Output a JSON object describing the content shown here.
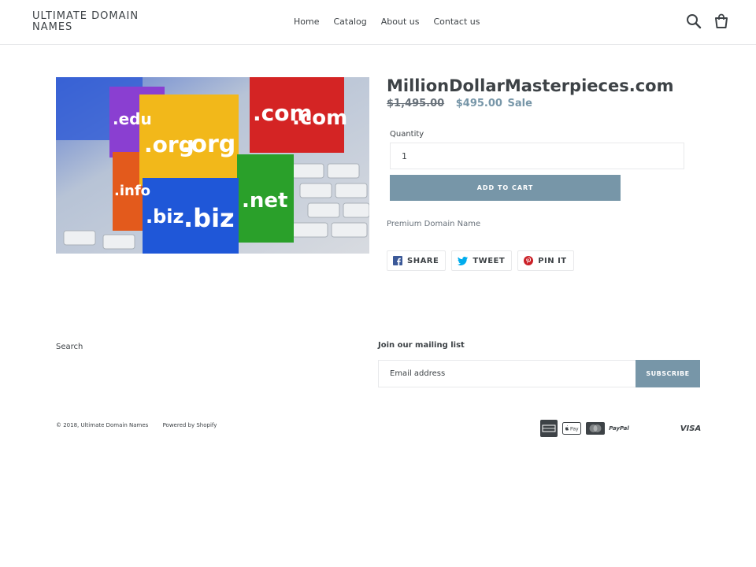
{
  "header": {
    "logo": "ULTIMATE DOMAIN NAMES",
    "nav": [
      "Home",
      "Catalog",
      "About us",
      "Contact us"
    ],
    "icons": [
      "search-icon",
      "cart-icon"
    ]
  },
  "product": {
    "image_alt": "Domain extension cubes on keyboard",
    "image_labels": [
      ".com",
      ".com",
      ".org",
      ".org",
      ".edu",
      ".info",
      ".biz",
      ".biz",
      ".net",
      ".net"
    ],
    "title": "MillionDollarMasterpieces.com",
    "price_original": "$1,495.00",
    "price_sale": "$495.00",
    "sale_label": "Sale",
    "quantity_label": "Quantity",
    "quantity_value": "1",
    "add_to_cart": "ADD TO CART",
    "description": "Premium Domain Name",
    "share": [
      {
        "label": "SHARE",
        "icon": "facebook-icon",
        "color": "#3b5998"
      },
      {
        "label": "TWEET",
        "icon": "twitter-icon",
        "color": "#00aced"
      },
      {
        "label": "PIN IT",
        "icon": "pinterest-icon",
        "color": "#cb2027"
      }
    ]
  },
  "footer": {
    "search_link": "Search",
    "mailing_title": "Join our mailing list",
    "email_placeholder": "Email address",
    "subscribe": "SUBSCRIBE",
    "copyright": "© 2018, Ultimate Domain Names",
    "powered": "Powered by Shopify",
    "payment_icons": [
      "american-express-icon",
      "apple-pay-icon",
      "mastercard-icon",
      "paypal-icon",
      "visa-icon"
    ],
    "payment_text": {
      "paypal": "PayPal",
      "visa": "VISA",
      "applepay": "Pay"
    }
  },
  "colors": {
    "accent": "#7796a8",
    "text": "#3d4246",
    "border": "#e8e9eb"
  }
}
